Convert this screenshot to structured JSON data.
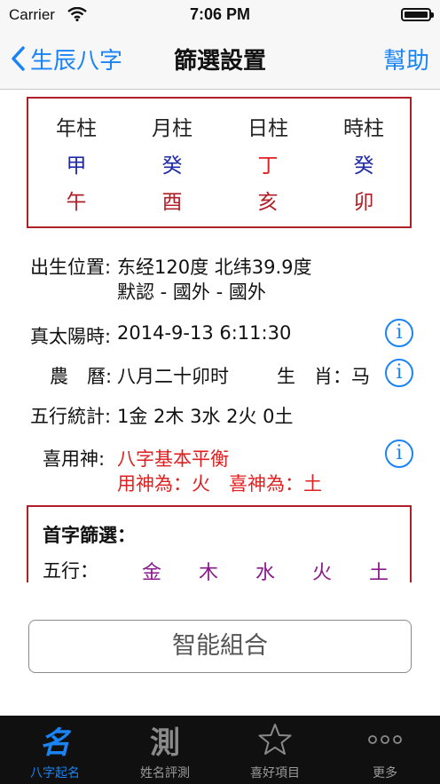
{
  "status_bar": {
    "carrier": "Carrier",
    "time": "7:06 PM"
  },
  "nav": {
    "back_label": "生辰八字",
    "title": "篩選設置",
    "help_label": "幫助"
  },
  "pillars": [
    {
      "header": "年柱",
      "stem": "甲",
      "branch": "午",
      "stem_color": "#1f2aa8"
    },
    {
      "header": "月柱",
      "stem": "癸",
      "branch": "酉",
      "stem_color": "#1f2aa8"
    },
    {
      "header": "日柱",
      "stem": "丁",
      "branch": "亥",
      "stem_color": "#e02020"
    },
    {
      "header": "時柱",
      "stem": "癸",
      "branch": "卯",
      "stem_color": "#1f2aa8"
    }
  ],
  "birth_location": {
    "label": "出生位置:",
    "line1": "东经120度 北纬39.9度",
    "line2": "默認 - 國外 - 國外"
  },
  "true_solar_time": {
    "label": "真太陽時:",
    "value": "2014-9-13 6:11:30"
  },
  "lunar": {
    "label": "農　曆:",
    "value": "八月二十卯时",
    "zodiac_label": "生　肖：",
    "zodiac_value": "马"
  },
  "five_elements_stats": {
    "label": "五行統計:",
    "value": "1金 2木 3水 2火 0土"
  },
  "favorable_god": {
    "label": "喜用神:",
    "line1": "八字基本平衡",
    "line2": "用神為：火　喜神為：土"
  },
  "first_char_filter": {
    "title": "首字篩選：",
    "elements_label": "五行：",
    "elements": [
      "金",
      "木",
      "水",
      "火",
      "土"
    ]
  },
  "smart_combine_label": "智能組合",
  "tabs": [
    {
      "icon_glyph": "名",
      "label": "八字起名",
      "active": true
    },
    {
      "icon_glyph": "測",
      "label": "姓名評測",
      "active": false
    },
    {
      "icon_glyph": "☆",
      "label": "喜好項目",
      "active": false
    },
    {
      "icon_glyph": "○○○",
      "label": "更多",
      "active": false
    }
  ],
  "colors": {
    "accent": "#1a84f5",
    "border_red": "#b01e28",
    "text_red": "#e02020",
    "stem_blue": "#1f2aa8",
    "element_purple": "#8a1a8c"
  }
}
